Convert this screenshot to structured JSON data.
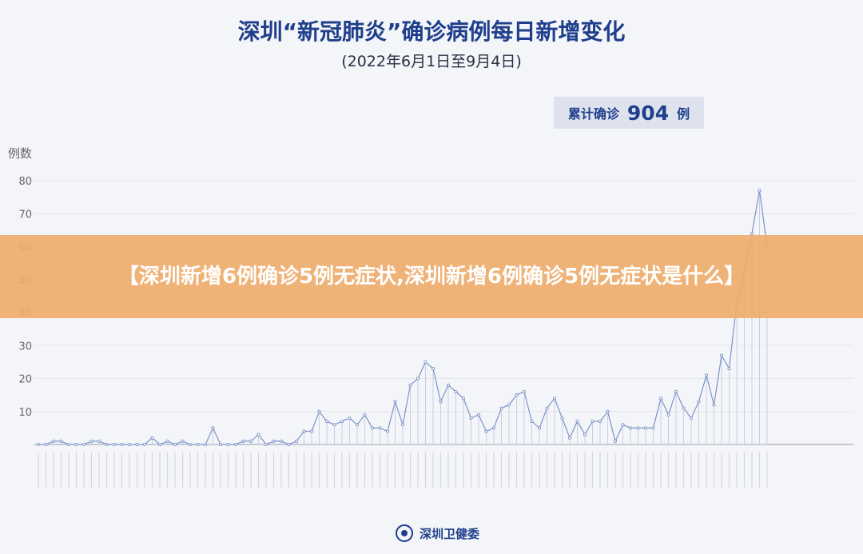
{
  "header": {
    "title": "深圳“新冠肺炎”确诊病例每日新增变化",
    "subtitle": "(2022年6月1日至9月4日)"
  },
  "total": {
    "label": "累计确诊",
    "value": "904",
    "unit": "例"
  },
  "banner": {
    "text": "【深圳新增6例确诊5例无症状,深圳新增6例确诊5例无症状是什么】"
  },
  "source": {
    "label": "深圳卫健委"
  },
  "colors": {
    "line": "#7b93c9",
    "title": "#1f3f8c",
    "banner": "#eeac6c"
  },
  "chart_data": {
    "type": "line",
    "ylabel": "例数",
    "ylim": [
      0,
      80
    ],
    "yticks": [
      10,
      20,
      30,
      40,
      50,
      60,
      70,
      80
    ],
    "grid": true,
    "values": [
      0,
      0,
      1,
      1,
      0,
      0,
      0,
      1,
      1,
      0,
      0,
      0,
      0,
      0,
      0,
      2,
      0,
      1,
      0,
      1,
      0,
      0,
      0,
      5,
      0,
      0,
      0,
      1,
      1,
      3,
      0,
      1,
      1,
      0,
      1,
      4,
      4,
      10,
      7,
      6,
      7,
      8,
      6,
      9,
      5,
      5,
      4,
      13,
      6,
      18,
      20,
      25,
      23,
      13,
      18,
      16,
      14,
      8,
      9,
      4,
      5,
      11,
      12,
      15,
      16,
      7,
      5,
      11,
      14,
      8,
      2,
      7,
      3,
      7,
      7,
      10,
      1,
      6,
      5,
      5,
      5,
      5,
      14,
      9,
      16,
      11,
      8,
      13,
      21,
      12,
      27,
      23,
      43,
      52,
      64,
      77,
      60
    ]
  }
}
